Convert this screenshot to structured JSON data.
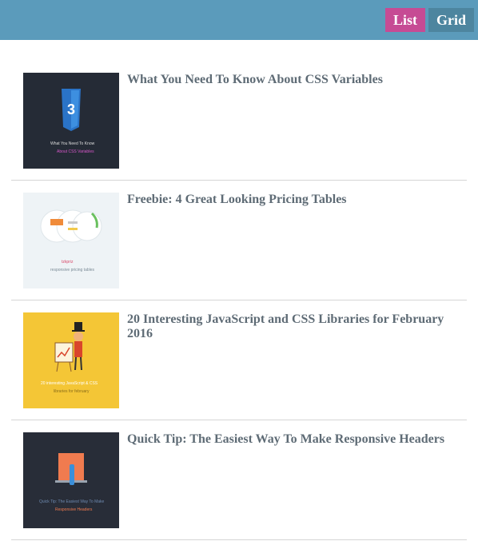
{
  "toolbar": {
    "list_label": "List",
    "grid_label": "Grid",
    "active_color": "#c64b94",
    "inactive_color": "#4d859f",
    "bar_color": "#5b9bbb"
  },
  "articles": [
    {
      "title": "What You Need To Know About CSS Variables",
      "thumb": {
        "bg": "#252b36",
        "icon": "css3-shield-icon",
        "caption1": "What You Need To Know",
        "caption2": "About CSS Variables"
      }
    },
    {
      "title": "Freebie: 4 Great Looking Pricing Tables",
      "thumb": {
        "bg": "#eef3f6",
        "icon": "pricing-tables-icon",
        "caption1": "tzkpriz",
        "caption2": "responsive pricing tables"
      }
    },
    {
      "title": "20 Interesting JavaScript and CSS Libraries for February 2016",
      "thumb": {
        "bg": "#f4c636",
        "icon": "guide-character-icon",
        "caption1": "20 interesting JavaScript & CSS",
        "caption2": "libraries for february"
      }
    },
    {
      "title": "Quick Tip: The Easiest Way To Make Responsive Headers",
      "thumb": {
        "bg": "#282d38",
        "icon": "laptop-header-icon",
        "caption1": "Quick Tip: The Easiest Way To Make",
        "caption2": "Responsive Headers"
      }
    }
  ]
}
